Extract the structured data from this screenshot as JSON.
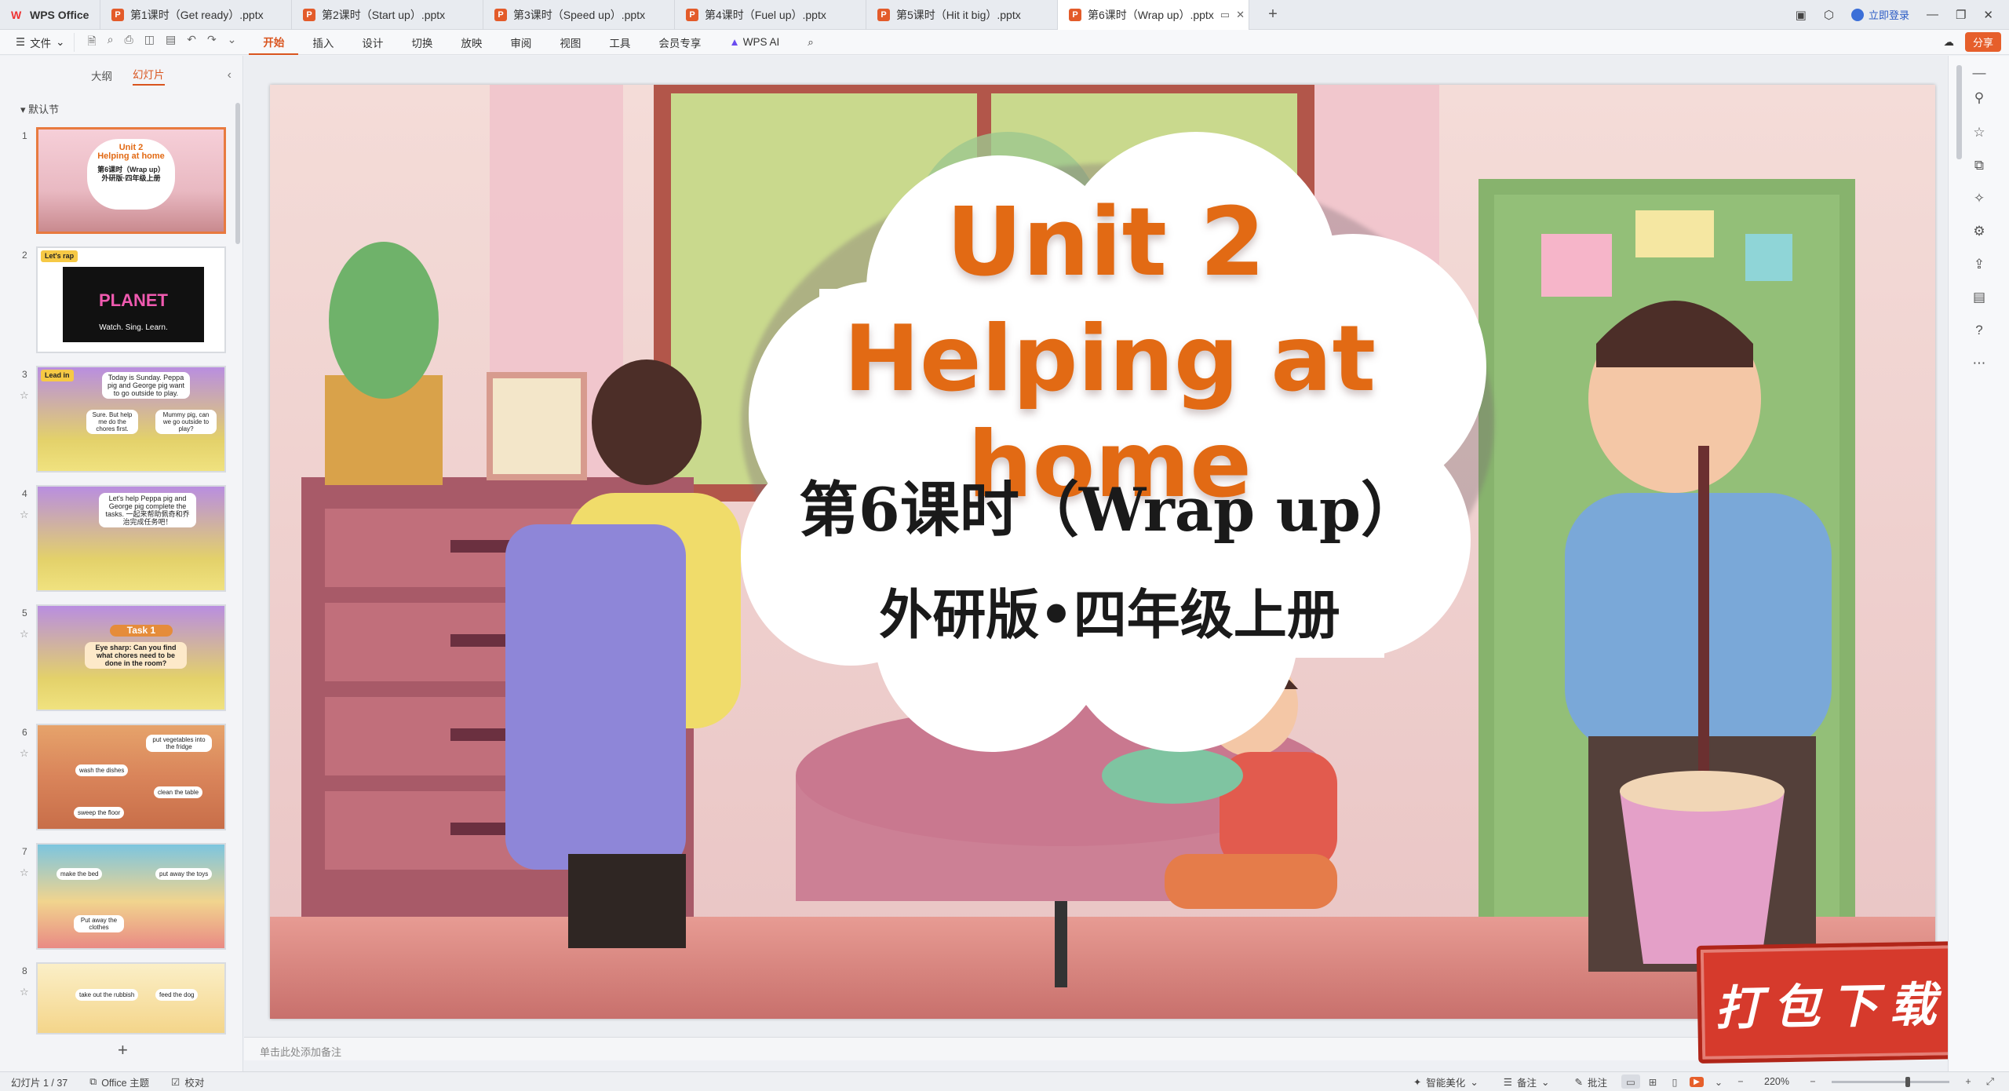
{
  "tabs": {
    "home": "WPS Office",
    "files": [
      {
        "label": "第1课时（Get ready）.pptx"
      },
      {
        "label": "第2课时（Start up）.pptx"
      },
      {
        "label": "第3课时（Speed up）.pptx"
      },
      {
        "label": "第4课时（Fuel up）.pptx"
      },
      {
        "label": "第5课时（Hit it big）.pptx"
      },
      {
        "label": "第6课时（Wrap up）.pptx"
      }
    ],
    "active_index": 5,
    "new_tab": "+",
    "login": "立即登录"
  },
  "ribbon": {
    "file": "文件",
    "menus": [
      "开始",
      "插入",
      "设计",
      "切换",
      "放映",
      "审阅",
      "视图",
      "工具",
      "会员专享"
    ],
    "active_menu": "开始",
    "wps_ai": "WPS AI",
    "share": "分享"
  },
  "left_panel": {
    "tab_outline": "大纲",
    "tab_slides": "幻灯片",
    "section": "默认节",
    "slides": [
      {
        "num": "1",
        "lines": [
          "Unit 2",
          "Helping at home",
          "第6课时（Wrap up）",
          "外研版·四年级上册"
        ]
      },
      {
        "num": "2",
        "lines": [
          "Let's rap",
          "PLANET",
          "Watch. Sing. Learn."
        ]
      },
      {
        "num": "3",
        "lines": [
          "Lead in",
          "Today is Sunday. Peppa pig and George pig want to go outside to play.",
          "Sure. But help me do the chores first.",
          "Mummy pig, can we go outside to play?"
        ]
      },
      {
        "num": "4",
        "lines": [
          "Let's help Peppa pig and George pig complete the tasks. 一起来帮助佩奇和乔治完成任务吧！"
        ]
      },
      {
        "num": "5",
        "lines": [
          "Task 1",
          "Eye sharp: Can you find what chores need to be done in the room?"
        ]
      },
      {
        "num": "6",
        "lines": [
          "put vegetables into the fridge",
          "wash the dishes",
          "clean the table",
          "sweep the floor"
        ]
      },
      {
        "num": "7",
        "lines": [
          "make the bed",
          "put away the toys",
          "Put away the clothes"
        ]
      },
      {
        "num": "8",
        "lines": [
          "take out the rubbish",
          "feed the dog"
        ]
      }
    ]
  },
  "slide": {
    "title_line1": "Unit 2",
    "title_line2": "Helping at home",
    "subtitle": "第6课时（Wrap up）",
    "edition": "外研版•四年级上册",
    "badge": "打包下载"
  },
  "notes_placeholder": "单击此处添加备注",
  "status": {
    "slide_counter": "幻灯片 1 / 37",
    "theme": "Office 主题",
    "proof": "校对",
    "beautify": "智能美化",
    "notes": "备注",
    "comments": "批注",
    "zoom": "220%"
  },
  "colors": {
    "accent": "#e65f2b",
    "title_orange": "#e26a14"
  }
}
